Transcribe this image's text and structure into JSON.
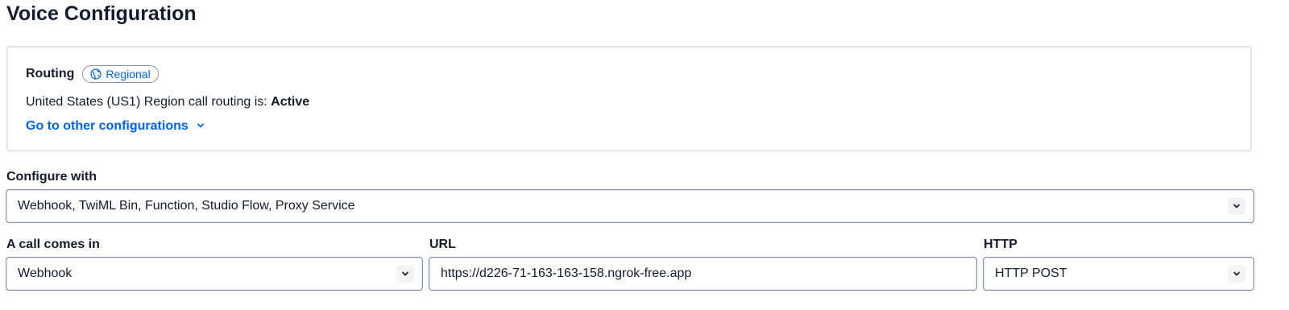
{
  "page_title": "Voice Configuration",
  "routing": {
    "label": "Routing",
    "badge": "Regional",
    "status_prefix": "United States (US1) Region call routing is: ",
    "status_value": "Active",
    "other_configs_link": "Go to other configurations"
  },
  "configure_with": {
    "label": "Configure with",
    "value": "Webhook, TwiML Bin, Function, Studio Flow, Proxy Service"
  },
  "call_comes_in": {
    "label": "A call comes in",
    "value": "Webhook"
  },
  "url": {
    "label": "URL",
    "value": "https://d226-71-163-163-158.ngrok-free.app"
  },
  "http": {
    "label": "HTTP",
    "value": "HTTP POST"
  },
  "colors": {
    "link": "#0263e0",
    "text": "#121c2d",
    "border": "#8891aa"
  },
  "icons": [
    "globe-icon",
    "chevron-down-icon"
  ]
}
